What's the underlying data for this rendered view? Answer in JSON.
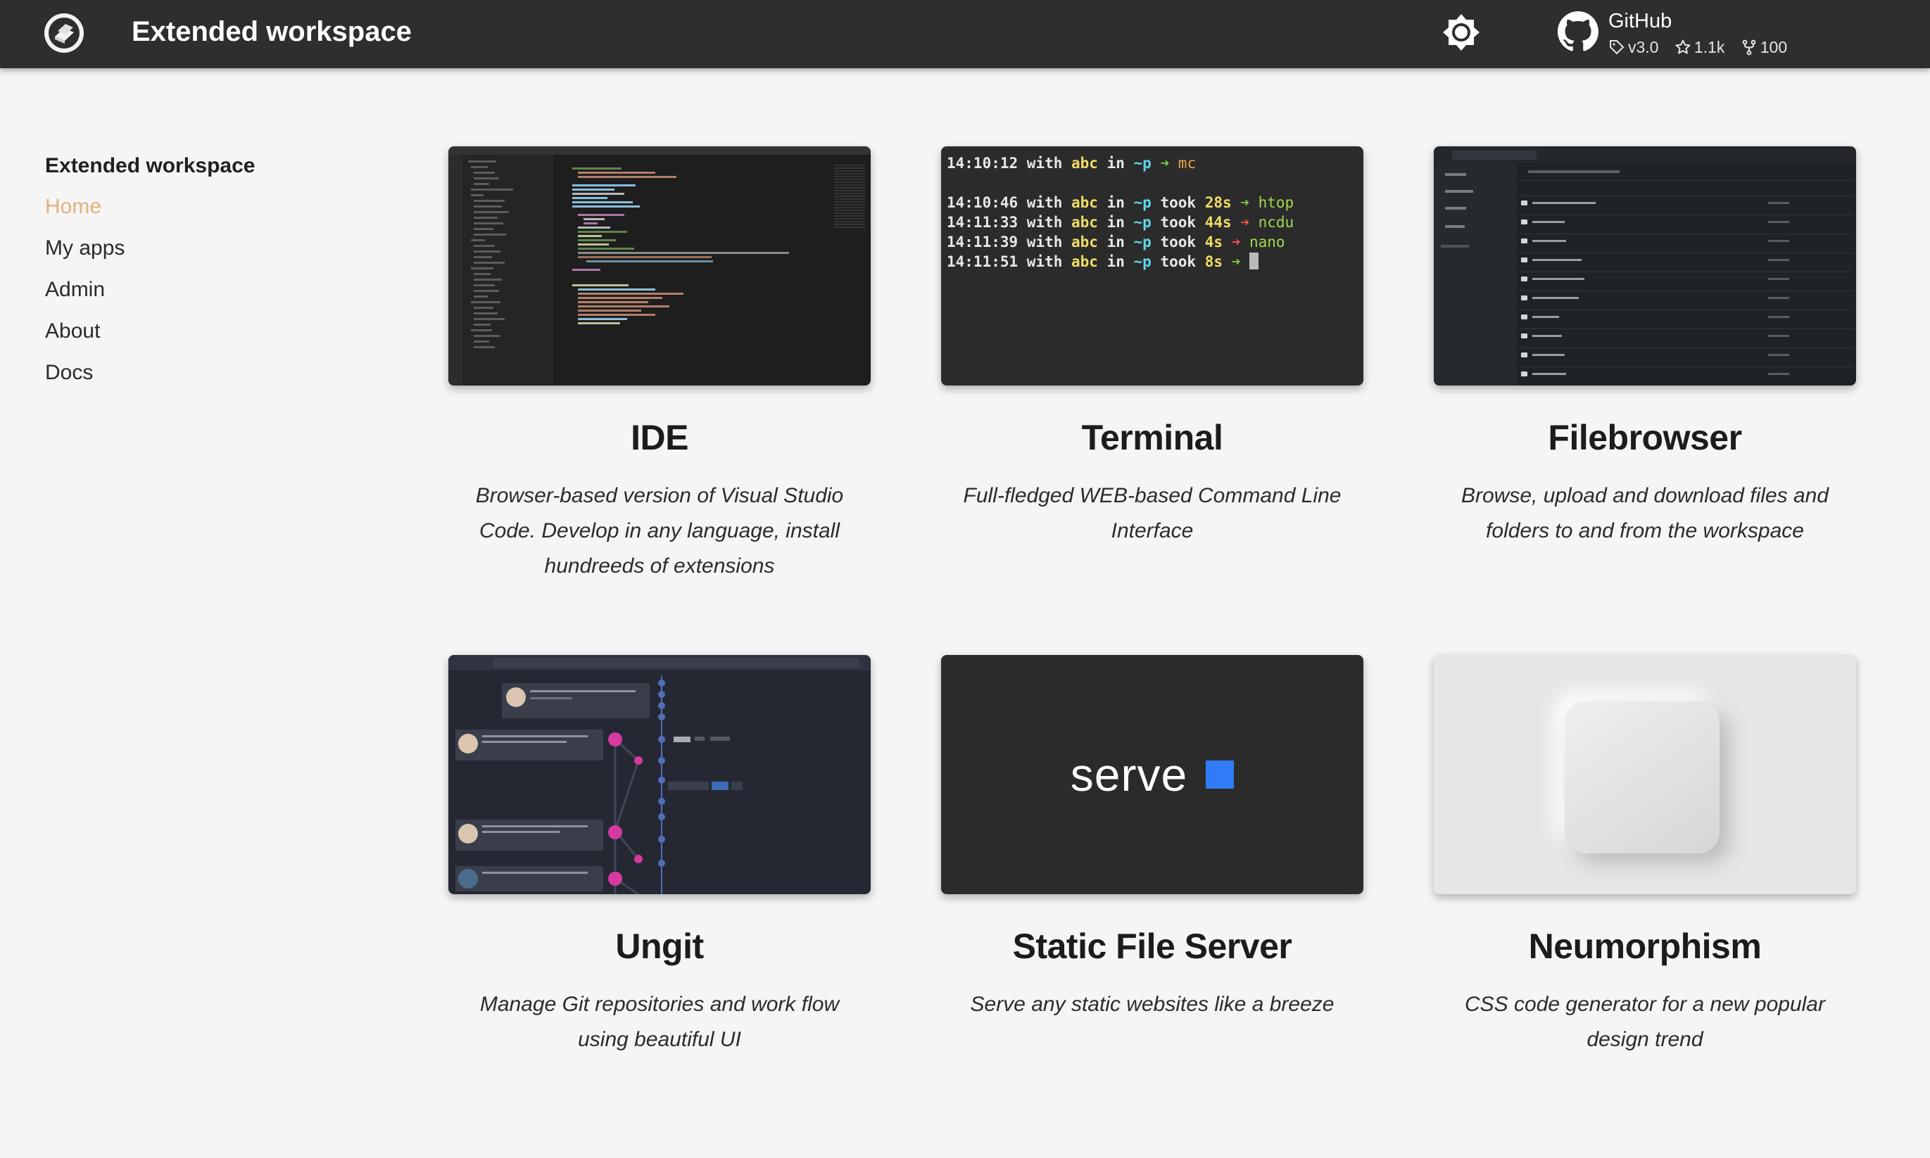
{
  "header": {
    "title": "Extended workspace",
    "repo": {
      "name": "GitHub",
      "version": "v3.0",
      "stars": "1.1k",
      "forks": "100"
    }
  },
  "sidebar": {
    "title": "Extended workspace",
    "items": [
      {
        "label": "Home",
        "active": true
      },
      {
        "label": "My apps"
      },
      {
        "label": "Admin"
      },
      {
        "label": "About"
      },
      {
        "label": "Docs"
      }
    ]
  },
  "colors": {
    "header_bg": "#2e2e2e",
    "page_bg": "#f5f5f5",
    "active_link": "#e2b27a",
    "serve_accent": "#2f7cf6"
  },
  "apps": [
    {
      "title": "IDE",
      "description": "Browser-based version of Visual Studio Code. Develop in any language, install hundreeds of extensions"
    },
    {
      "title": "Terminal",
      "description": "Full-fledged WEB-based Command Line Interface"
    },
    {
      "title": "Filebrowser",
      "description": "Browse, upload and download files and folders to and from the workspace"
    },
    {
      "title": "Ungit",
      "description": "Manage Git repositories and work flow using beautiful UI"
    },
    {
      "title": "Static File Server",
      "description": "Serve any static websites like a breeze"
    },
    {
      "title": "Neumorphism",
      "description": "CSS code generator for a new popular design trend"
    }
  ],
  "terminal": {
    "lines": [
      {
        "time": "14:10:12",
        "user": "abc",
        "dir": "~p",
        "took": "",
        "status": "ok",
        "cmd": "mc"
      },
      {
        "time": "14:10:46",
        "user": "abc",
        "dir": "~p",
        "took": "28s",
        "status": "ok",
        "cmd": "htop"
      },
      {
        "time": "14:11:33",
        "user": "abc",
        "dir": "~p",
        "took": "44s",
        "status": "err",
        "cmd": "ncdu"
      },
      {
        "time": "14:11:39",
        "user": "abc",
        "dir": "~p",
        "took": "4s",
        "status": "err",
        "cmd": "nano"
      },
      {
        "time": "14:11:51",
        "user": "abc",
        "dir": "~p",
        "took": "8s",
        "status": "ok",
        "cmd": ""
      }
    ]
  },
  "serve": {
    "label": "serve"
  }
}
